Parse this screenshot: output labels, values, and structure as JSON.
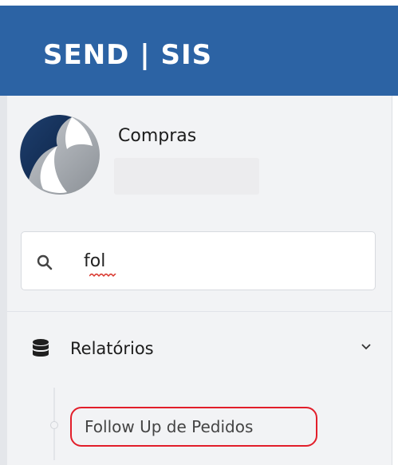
{
  "header": {
    "brand": "SEND | SIS",
    "background_color": "#2c63a4"
  },
  "profile": {
    "title": "Compras",
    "logo_icon": "company-logo-icon"
  },
  "search": {
    "icon": "search-icon",
    "value": "fol"
  },
  "menu": {
    "group": {
      "icon": "database-icon",
      "label": "Relatórios",
      "expand_icon": "chevron-down-icon"
    },
    "items": [
      {
        "label": "Follow Up de Pedidos",
        "highlighted": true
      }
    ]
  },
  "colors": {
    "sidebar_bg": "#f2f3f5",
    "highlight": "#e21e2a",
    "accent": "#2c63a4"
  }
}
